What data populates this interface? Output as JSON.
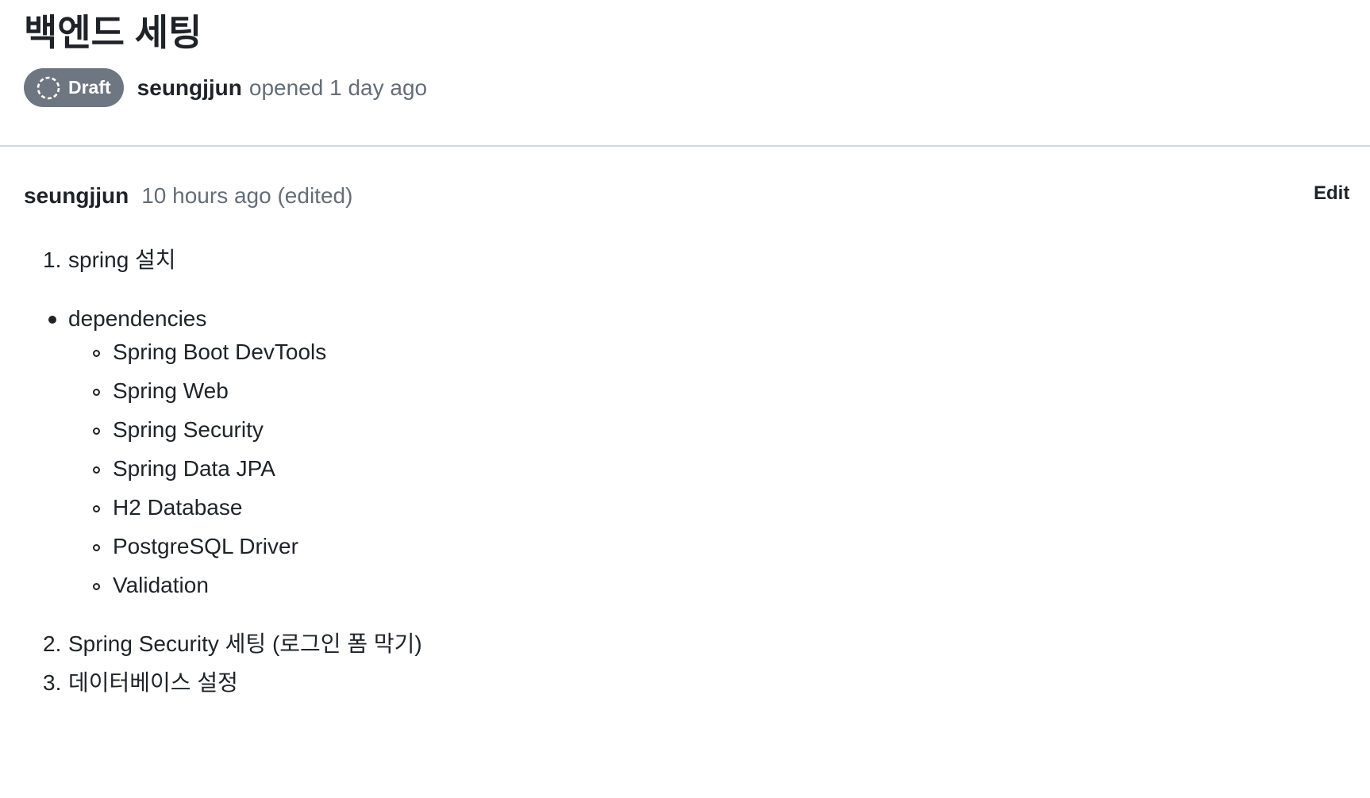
{
  "header": {
    "title": "백엔드 세팅",
    "status_badge": "Draft",
    "author": "seungjjun",
    "opened_text": "opened 1 day ago"
  },
  "comment": {
    "author": "seungjjun",
    "time": "10 hours ago (edited)",
    "edit_label": "Edit",
    "items": {
      "step1_number": "1.",
      "step1_text": "spring 설치",
      "dependencies_label": "dependencies",
      "dependencies": [
        "Spring Boot DevTools",
        "Spring Web",
        "Spring Security",
        "Spring Data JPA",
        "H2 Database",
        "PostgreSQL Driver",
        "Validation"
      ],
      "step2_number": "2.",
      "step2_text": "Spring Security 세팅 (로그인 폼 막기)",
      "step3_number": "3.",
      "step3_text": "데이터베이스 설정"
    }
  },
  "colors": {
    "text": "#1f2328",
    "muted": "#656d76",
    "badge_bg": "#6e7781",
    "divider": "#d0d7de"
  }
}
